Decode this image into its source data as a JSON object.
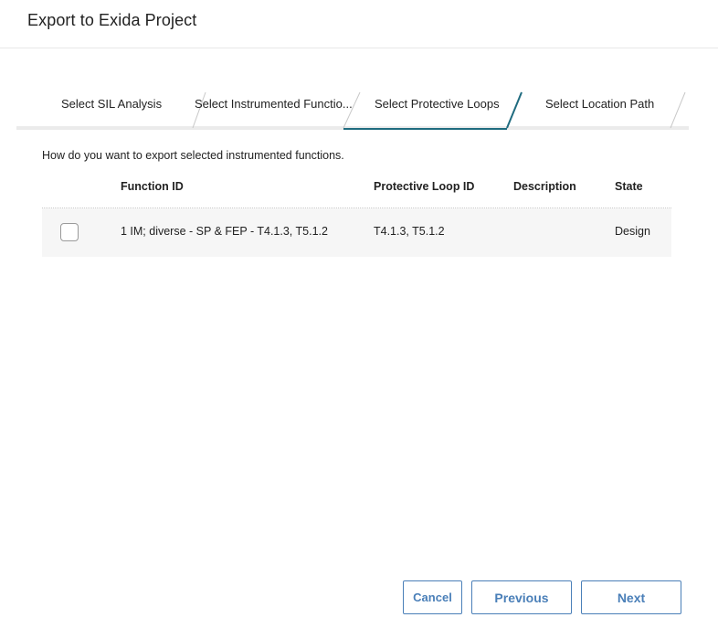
{
  "dialog": {
    "title": "Export to Exida Project"
  },
  "stepper": {
    "steps": [
      {
        "label": "Select SIL Analysis",
        "active": false
      },
      {
        "label": "Select Instrumented Functio...",
        "active": false
      },
      {
        "label": "Select Protective Loops",
        "active": true
      },
      {
        "label": "Select Location Path",
        "active": false
      }
    ],
    "accent_color": "#1f6b7f"
  },
  "content": {
    "prompt": "How do you want to export selected instrumented functions."
  },
  "table": {
    "columns": [
      "Function ID",
      "Protective Loop ID",
      "Description",
      "State"
    ],
    "rows": [
      {
        "checked": false,
        "function_id": "1 IM; diverse - SP & FEP - T4.1.3, T5.1.2",
        "protective_loop_id": "T4.1.3, T5.1.2",
        "description": "",
        "state": "Design"
      }
    ]
  },
  "footer": {
    "cancel_label": "Cancel",
    "previous_label": "Previous",
    "next_label": "Next",
    "button_color": "#4a7fb8"
  }
}
